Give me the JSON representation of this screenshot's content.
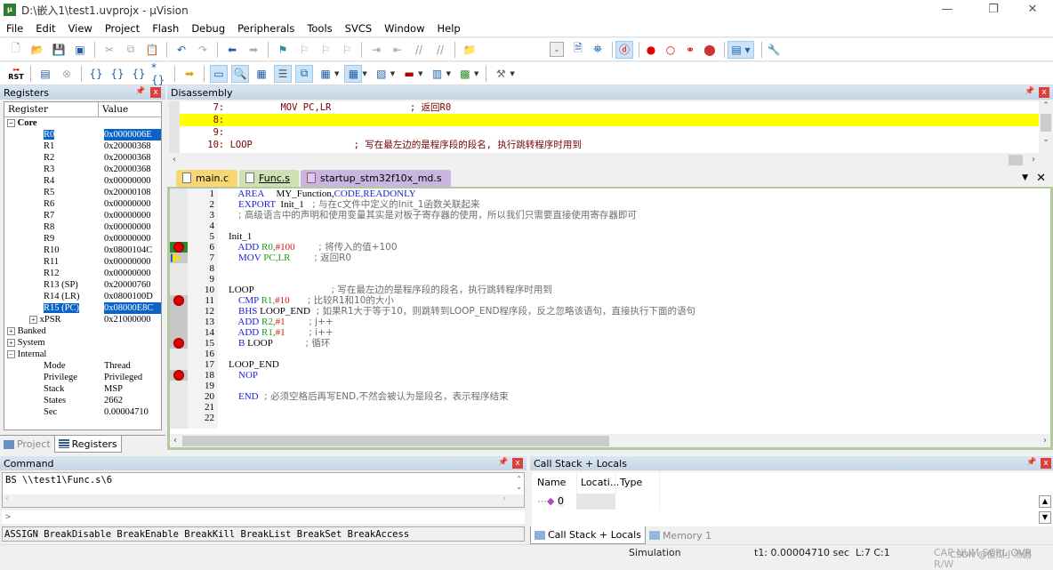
{
  "window": {
    "title": "D:\\嵌入1\\test1.uvprojx - µVision",
    "app_icon": "uvision-icon",
    "controls": [
      "minimize",
      "restore",
      "close"
    ]
  },
  "menu": [
    "File",
    "Edit",
    "View",
    "Project",
    "Flash",
    "Debug",
    "Peripherals",
    "Tools",
    "SVCS",
    "Window",
    "Help"
  ],
  "toolbar1": {
    "icons": [
      "new-file-icon",
      "open-folder-icon",
      "save-icon",
      "save-all-icon",
      "cut-icon",
      "copy-icon",
      "paste-icon",
      "undo-icon",
      "redo-icon",
      "nav-back-icon",
      "nav-forward-icon",
      "bookmark-icon",
      "prev-bookmark-icon",
      "next-bookmark-icon",
      "clear-bookmarks-icon",
      "indent-icon",
      "unindent-icon",
      "comment-icon",
      "uncomment-icon",
      "find-in-files-icon"
    ],
    "right_icons": [
      "combo-dropdown",
      "find-icon",
      "binoculars-icon",
      "debug-session-icon",
      "insert-breakpoint-icon",
      "enable-breakpoint-icon",
      "disable-all-breakpoints-icon",
      "kill-all-breakpoints-icon",
      "window-layout-icon",
      "configure-icon"
    ]
  },
  "toolbar2": {
    "icons": [
      "reset-icon",
      "run-icon",
      "stop-icon",
      "step-into-icon",
      "step-over-icon",
      "step-out-icon",
      "run-to-cursor-icon",
      "show-next-statement-icon",
      "command-window-icon",
      "disassembly-window-icon",
      "symbols-window-icon",
      "registers-window-icon",
      "call-stack-window-icon",
      "watch-window-icon",
      "memory-window-icon",
      "serial-window-icon",
      "analysis-window-icon",
      "trace-window-icon",
      "system-viewer-icon",
      "toolbox-icon"
    ],
    "reset_label": "RST"
  },
  "registers": {
    "title": "Registers",
    "columns": [
      "Register",
      "Value"
    ],
    "core_label": "Core",
    "rows": [
      {
        "name": "R0",
        "value": "0x0000006E",
        "selected": true
      },
      {
        "name": "R1",
        "value": "0x20000368"
      },
      {
        "name": "R2",
        "value": "0x20000368"
      },
      {
        "name": "R3",
        "value": "0x20000368"
      },
      {
        "name": "R4",
        "value": "0x00000000"
      },
      {
        "name": "R5",
        "value": "0x20000108"
      },
      {
        "name": "R6",
        "value": "0x00000000"
      },
      {
        "name": "R7",
        "value": "0x00000000"
      },
      {
        "name": "R8",
        "value": "0x00000000"
      },
      {
        "name": "R9",
        "value": "0x00000000"
      },
      {
        "name": "R10",
        "value": "0x0800104C"
      },
      {
        "name": "R11",
        "value": "0x00000000"
      },
      {
        "name": "R12",
        "value": "0x00000000"
      },
      {
        "name": "R13 (SP)",
        "value": "0x20000760"
      },
      {
        "name": "R14 (LR)",
        "value": "0x0800100D"
      },
      {
        "name": "R15 (PC)",
        "value": "0x08000E8C",
        "selected": true
      },
      {
        "name": "xPSR",
        "value": "0x21000000"
      }
    ],
    "groups": [
      "Banked",
      "System",
      "Internal"
    ],
    "internal": [
      {
        "name": "Mode",
        "value": "Thread"
      },
      {
        "name": "Privilege",
        "value": "Privileged"
      },
      {
        "name": "Stack",
        "value": "MSP"
      },
      {
        "name": "States",
        "value": "2662"
      },
      {
        "name": "Sec",
        "value": "0.00004710"
      }
    ],
    "tabs": [
      "Project",
      "Registers"
    ]
  },
  "disassembly": {
    "title": "Disassembly",
    "lines": [
      {
        "text": "     7:          MOV PC,LR              ; 返回R0"
      },
      {
        "text": "     8:",
        "highlight": true
      },
      {
        "text": "     9:"
      },
      {
        "text": "    10: LOOP                  ; 写在最左边的是程序段的段名, 执行跳转程序时用到"
      }
    ]
  },
  "editor": {
    "tabs": [
      {
        "label": "main.c",
        "color": "#f7d774"
      },
      {
        "label": "Func.s",
        "color": "#cfe0b4",
        "active": true
      },
      {
        "label": "startup_stm32f10x_md.s",
        "color": "#c9b6e0"
      }
    ],
    "lines": [
      {
        "n": "1",
        "i": "    ",
        "kw": "AREA",
        "rest": "     MY_Function,",
        "kw2": "CODE,READONLY"
      },
      {
        "n": "2",
        "i": "    ",
        "kw": "EXPORT",
        "rest": "  Init_1 ",
        "cm": "  ; 与在c文件中定义的Init_1函数关联起来"
      },
      {
        "n": "3",
        "i": "    ",
        "cm": "; 高级语言中的声明和使用变量其实是对板子寄存器的使用，所以我们只需要直接使用寄存器即可"
      },
      {
        "n": "4"
      },
      {
        "n": "5",
        "rest": "Init_1"
      },
      {
        "n": "6",
        "i": "    ",
        "kw": "ADD",
        "reg": " R0,",
        "num": "#100",
        "cm": "        ; 将传入的值+100"
      },
      {
        "n": "7",
        "i": "    ",
        "kw": "MOV",
        "reg": " PC,LR",
        "cm": "        ; 返回R0"
      },
      {
        "n": "8"
      },
      {
        "n": "9"
      },
      {
        "n": "10",
        "rest": "LOOP",
        "cm": "                          ; 写在最左边的是程序段的段名，执行跳转程序时用到"
      },
      {
        "n": "11",
        "i": "    ",
        "kw": "CMP",
        "reg": " R1,",
        "num": "#10",
        "cm": "      ; 比较R1和10的大小"
      },
      {
        "n": "12",
        "i": "    ",
        "kw": "BHS",
        "rest": " LOOP_END",
        "cm": "  ; 如果R1大于等于10，则跳转到LOOP_END程序段，反之忽略该语句，直接执行下面的语句"
      },
      {
        "n": "13",
        "i": "    ",
        "kw": "ADD",
        "reg": " R2,",
        "num": "#1",
        "cm": "        ; j++"
      },
      {
        "n": "14",
        "i": "    ",
        "kw": "ADD",
        "reg": " R1,",
        "num": "#1",
        "cm": "        ; i++"
      },
      {
        "n": "15",
        "i": "    ",
        "kw": "B",
        "rest": " LOOP",
        "cm": "           ; 循环"
      },
      {
        "n": "16"
      },
      {
        "n": "17",
        "rest": "LOOP_END"
      },
      {
        "n": "18",
        "i": "    ",
        "kw": "NOP"
      },
      {
        "n": "19"
      },
      {
        "n": "20",
        "i": "    ",
        "kw": "END",
        "cm": "  ; 必须空格后再写END,不然会被认为是段名，表示程序结束"
      },
      {
        "n": "21"
      },
      {
        "n": "22"
      }
    ],
    "breakpoints": [
      6,
      11,
      15,
      18
    ],
    "current_line": 7
  },
  "command": {
    "title": "Command",
    "output": "BS \\\\test1\\Func.s\\6",
    "prompt": ">",
    "input": "",
    "hints": "ASSIGN BreakDisable BreakEnable BreakKill BreakList BreakSet BreakAccess"
  },
  "callstack": {
    "title": "Call Stack + Locals",
    "columns": [
      "Name",
      "Locati...",
      "Type"
    ],
    "rows": [
      {
        "name": "0",
        "location": "",
        "type": ""
      }
    ],
    "tabs": [
      "Call Stack + Locals",
      "Memory 1"
    ]
  },
  "status": {
    "mode": "Simulation",
    "time": "t1: 0.00004710 sec",
    "cursor": "L:7 C:1",
    "indicators": "CAP  NUM  SCRL  OVR  R/W",
    "watermark": "CSDN @傻瓜小汤圆"
  }
}
